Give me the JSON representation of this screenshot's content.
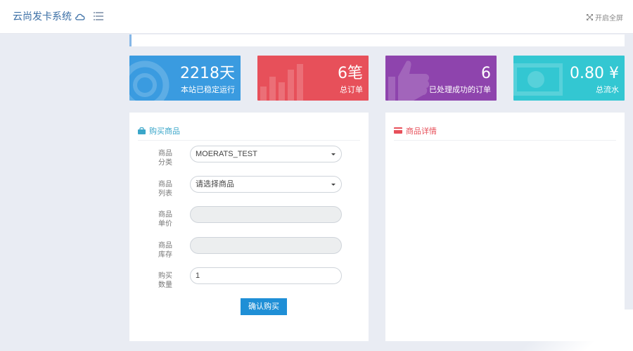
{
  "header": {
    "brand": "云尚发卡系统",
    "fullscreen_label": "开启全屏"
  },
  "stats": [
    {
      "value": "2218天",
      "label": "本站已稳定运行",
      "color": "#3a9be0"
    },
    {
      "value": "6笔",
      "label": "总订单",
      "color": "#e7505a"
    },
    {
      "value": "6",
      "label": "已处理成功的订单",
      "color": "#8e44ad"
    },
    {
      "value": "0.80 ¥",
      "label": "总流水",
      "color": "#33c7d2"
    }
  ],
  "buy_panel": {
    "title": "购买商品",
    "fields": {
      "category": {
        "label": "商品分类",
        "value": "MOERATS_TEST"
      },
      "product": {
        "label": "商品列表",
        "value": "请选择商品"
      },
      "price": {
        "label": "商品单价",
        "value": ""
      },
      "stock": {
        "label": "商品库存",
        "value": ""
      },
      "quantity": {
        "label": "购买数量",
        "value": "1"
      }
    },
    "confirm_label": "确认购买"
  },
  "detail_panel": {
    "title": "商品详情"
  }
}
